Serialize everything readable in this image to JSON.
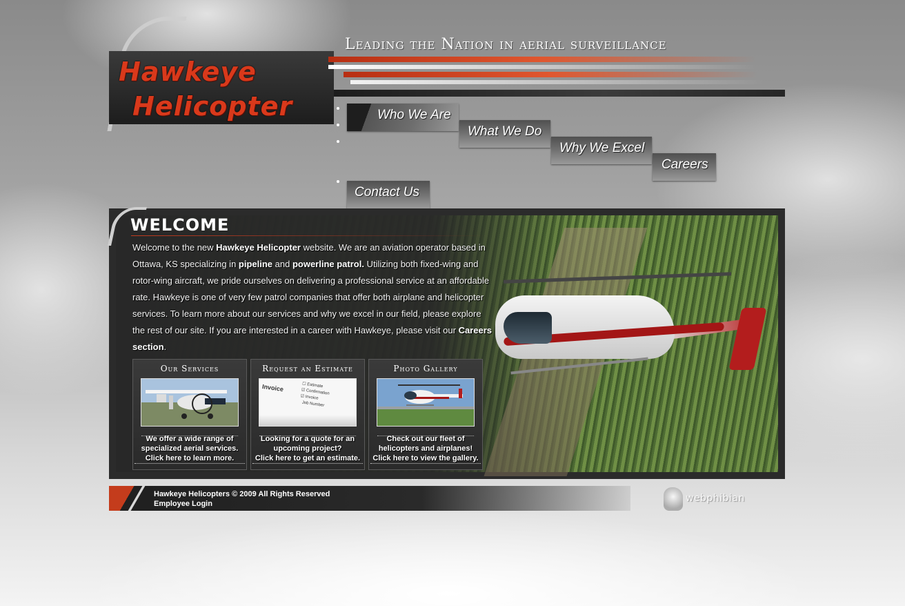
{
  "header": {
    "logo_line1": "Hawkeye",
    "logo_line2": "Helicopter",
    "tagline": "Leading the Nation in aerial surveillance"
  },
  "nav": {
    "items": [
      {
        "label": "Who We Are"
      },
      {
        "label": "What We Do"
      },
      {
        "label": "Why We Excel"
      },
      {
        "label": "Careers"
      },
      {
        "label": "Contact Us"
      }
    ]
  },
  "welcome": {
    "title": "WELCOME",
    "p1": "Welcome to the new ",
    "b1": "Hawkeye Helicopter",
    "p2": " website. We are an aviation operator based in Ottawa, KS specializing in ",
    "b2": "pipeline",
    "p3": " and ",
    "b3": "powerline patrol.",
    "p4": " Utilizing both fixed-wing and rotor-wing aircraft, we pride ourselves on delivering a professional service at an affordable rate. Hawkeye is one of very few patrol companies that offer both airplane and helicopter services. To learn more about our services and why we excel in our field, please explore the rest of our site. If you are interested in a career with Hawkeye, please visit our ",
    "b4": "Careers section",
    "p5": "."
  },
  "boxes": [
    {
      "title": "Our Services",
      "text1": "We offer a wide range of",
      "text2": "specialized aerial services.",
      "link": "Click here to learn more."
    },
    {
      "title": "Request an Estimate",
      "text1": "Looking for a quote for an",
      "text2": "upcoming project?",
      "link": "Click here to get an estimate."
    },
    {
      "title": "Photo Gallery",
      "text1": "Check out our fleet of",
      "text2": "helicopters and airplanes!",
      "link": "Click here to view the gallery."
    }
  ],
  "invoice": {
    "title": "Invoice",
    "items": [
      "Estimate",
      "Confirmation",
      "Invoice",
      "Job Number"
    ]
  },
  "footer": {
    "copyright": "Hawkeye Helicopters © 2009 All Rights Reserved",
    "login": "Employee Login",
    "credit": "webphibian"
  },
  "colors": {
    "accent_red": "#c43c1c",
    "panel_dark": "#2b2b2b"
  }
}
